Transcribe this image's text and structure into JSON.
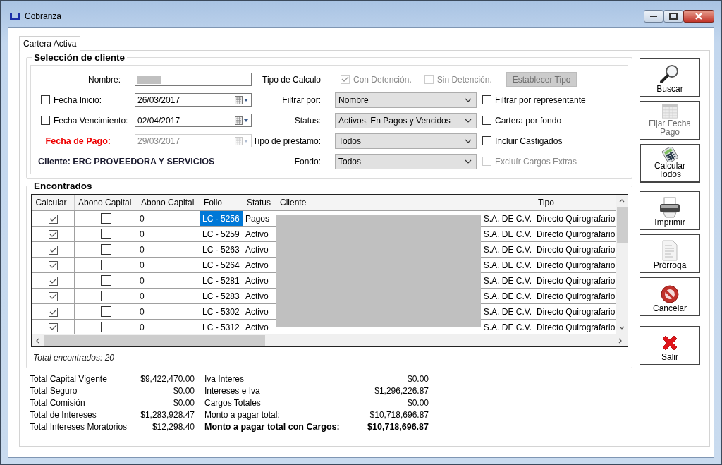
{
  "window": {
    "title": "Cobranza"
  },
  "tabs": [
    {
      "label": "Cartera Activa",
      "selected": true
    }
  ],
  "seleccion": {
    "title": "Selección de cliente",
    "nombre": {
      "label": "Nombre:",
      "redacted": true
    },
    "fecha_inicio": {
      "label": "Fecha Inicio:",
      "checked": false,
      "value": "26/03/2017",
      "disabled": false
    },
    "fecha_vencimiento": {
      "label": "Fecha Vencimiento:",
      "checked": false,
      "value": "02/04/2017",
      "disabled": false
    },
    "fecha_pago": {
      "label": "Fecha de Pago:",
      "value": "29/03/2017",
      "disabled": true
    },
    "cliente": "Cliente: ERC PROVEEDORA Y SERVICIOS",
    "tipo_calculo": {
      "label": "Tipo de Calculo",
      "options": [
        {
          "label": "Con Detención.",
          "checked": true,
          "disabled": true
        },
        {
          "label": "Sin Detención.",
          "checked": false,
          "disabled": true
        }
      ],
      "button": {
        "label": "Establecer Tipo",
        "disabled": true
      }
    },
    "dropdowns": [
      {
        "label": "Filtrar por:",
        "value": "Nombre"
      },
      {
        "label": "Status:",
        "value": "Activos, En Pagos y Vencidos"
      },
      {
        "label": "Tipo de préstamo:",
        "value": "Todos"
      },
      {
        "label": "Fondo:",
        "value": "Todos"
      }
    ],
    "checks": [
      {
        "label": "Filtrar por representante",
        "checked": false,
        "disabled": false
      },
      {
        "label": "Cartera por fondo",
        "checked": false,
        "disabled": false
      },
      {
        "label": "Incluir Castigados",
        "checked": false,
        "disabled": false
      },
      {
        "label": "Excluír Cargos Extras",
        "checked": false,
        "disabled": true
      }
    ]
  },
  "encontrados": {
    "title": "Encontrados",
    "table": {
      "columns": [
        "Calcular",
        "Abono Capital",
        "Abono Capital",
        "Folio",
        "Status",
        "Cliente",
        "Tipo"
      ],
      "redacted": true,
      "rows": [
        {
          "calcular": true,
          "abono_check": false,
          "abono": "0",
          "folio": "LC - 5256",
          "status": "Pagos",
          "cliente_end": "S.A. DE C.V.",
          "tipo": "Directo Quirografario",
          "selected": true
        },
        {
          "calcular": true,
          "abono_check": false,
          "abono": "0",
          "folio": "LC - 5259",
          "status": "Activo",
          "cliente_end": "S.A. DE C.V.",
          "tipo": "Directo Quirografario",
          "selected": false
        },
        {
          "calcular": true,
          "abono_check": false,
          "abono": "0",
          "folio": "LC - 5263",
          "status": "Activo",
          "cliente_end": "S.A. DE C.V.",
          "tipo": "Directo Quirografario",
          "selected": false
        },
        {
          "calcular": true,
          "abono_check": false,
          "abono": "0",
          "folio": "LC - 5264",
          "status": "Activo",
          "cliente_end": "S.A. DE C.V.",
          "tipo": "Directo Quirografario",
          "selected": false
        },
        {
          "calcular": true,
          "abono_check": false,
          "abono": "0",
          "folio": "LC - 5281",
          "status": "Activo",
          "cliente_end": "S.A. DE C.V.",
          "tipo": "Directo Quirografario",
          "selected": false
        },
        {
          "calcular": true,
          "abono_check": false,
          "abono": "0",
          "folio": "LC - 5283",
          "status": "Activo",
          "cliente_end": "S.A. DE C.V.",
          "tipo": "Directo Quirografario",
          "selected": false
        },
        {
          "calcular": true,
          "abono_check": false,
          "abono": "0",
          "folio": "LC - 5302",
          "status": "Activo",
          "cliente_end": "S.A. DE C.V.",
          "tipo": "Directo Quirografario",
          "selected": false
        },
        {
          "calcular": true,
          "abono_check": false,
          "abono": "0",
          "folio": "LC - 5312",
          "status": "Activo",
          "cliente_end": "S.A. DE C.V.",
          "tipo": "Directo Quirografario",
          "selected": false
        }
      ]
    },
    "total": "Total encontrados: 20"
  },
  "totals": [
    [
      {
        "label": "Total Capital Vigente",
        "value": "$9,422,470.00",
        "bold": false
      },
      {
        "label": "Total Seguro",
        "value": "$0.00",
        "bold": false
      },
      {
        "label": "Total Comisión",
        "value": "$0.00",
        "bold": false
      },
      {
        "label": "Total de Intereses",
        "value": "$1,283,928.47",
        "bold": false
      },
      {
        "label": "Total Intereses Moratorios",
        "value": "$12,298.40",
        "bold": false
      }
    ],
    [
      {
        "label": "Iva Interes",
        "value": "$0.00",
        "bold": false
      },
      {
        "label": "Intereses e Iva",
        "value": "$1,296,226.87",
        "bold": false
      },
      {
        "label": "Cargos Totales",
        "value": "$0.00",
        "bold": false
      },
      {
        "label": "Monto a pagar total:",
        "value": "$10,718,696.87",
        "bold": false
      },
      {
        "label": "Monto a pagar total con Cargos:",
        "value": "$10,718,696.87",
        "bold": true
      }
    ]
  ],
  "button_groups": [
    [
      {
        "label": "Buscar",
        "kind": "search",
        "disabled": false,
        "focused": false
      },
      {
        "label": "Fijar Fecha Pago",
        "kind": "calendar",
        "disabled": true,
        "focused": false
      },
      {
        "label": "Calcular Todos",
        "kind": "calculator",
        "disabled": false,
        "focused": true
      }
    ],
    [
      {
        "label": "Imprimir",
        "kind": "printer",
        "disabled": false,
        "focused": false
      },
      {
        "label": "Prórroga",
        "kind": "document",
        "disabled": false,
        "focused": false
      },
      {
        "label": "Cancelar",
        "kind": "cancel",
        "disabled": false,
        "focused": false
      }
    ],
    [
      {
        "label": "Salir",
        "kind": "exit",
        "disabled": false,
        "focused": false
      }
    ]
  ]
}
